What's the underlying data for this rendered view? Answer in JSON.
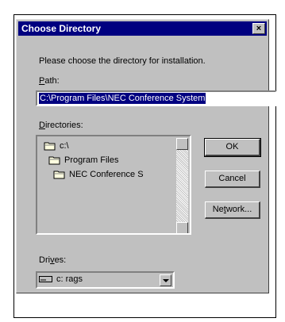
{
  "dialog": {
    "title": "Choose Directory",
    "close_label": "×",
    "instruction": "Please choose the directory for installation.",
    "path_label_pre": "",
    "path_label_u": "P",
    "path_label_post": "ath:",
    "path_value": "C:\\Program Files\\NEC Conference System",
    "dirs_label_u": "D",
    "dirs_label_post": "irectories:",
    "directories": [
      {
        "label": "c:\\"
      },
      {
        "label": "Program Files"
      },
      {
        "label": "NEC Conference S"
      }
    ],
    "buttons": {
      "ok": "OK",
      "cancel": "Cancel",
      "network_pre": "Ne",
      "network_u": "t",
      "network_post": "work..."
    },
    "drives_label_pre": "Dri",
    "drives_label_u": "v",
    "drives_label_post": "es:",
    "drive_value": "c: rags"
  }
}
